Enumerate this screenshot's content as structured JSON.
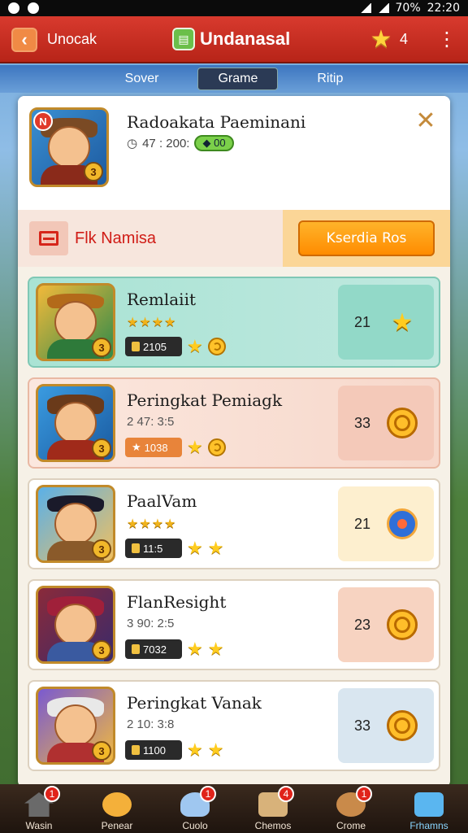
{
  "status_bar": {
    "battery": "70%",
    "time": "22:20"
  },
  "header": {
    "back_label": "Unocak",
    "title": "Undanasal",
    "star_count": "4"
  },
  "tabs": [
    {
      "label": "Sover"
    },
    {
      "label": "Grame"
    },
    {
      "label": "Ritip"
    }
  ],
  "profile": {
    "name": "Radoakata Paeminani",
    "meta": "47 : 200:",
    "pill": "00",
    "level": "3",
    "badge": "N"
  },
  "actions": {
    "left_label": "Flk Namisa",
    "right_button": "Kserdia Ros"
  },
  "players": [
    {
      "name": "Remlaiit",
      "stars": "★★★★",
      "sub": "",
      "chip": "2105",
      "rank": "21",
      "level": "3",
      "icon": "star-icon",
      "chip_style": "dark"
    },
    {
      "name": "Peringkat Pemiagk",
      "stars": "",
      "sub": "2 47: 3:5",
      "chip": "1038",
      "rank": "33",
      "level": "3",
      "icon": "ring-icon",
      "chip_style": "orange"
    },
    {
      "name": "PaalVam",
      "stars": "★★★★",
      "sub": "",
      "chip": "11:5",
      "rank": "21",
      "level": "3",
      "icon": "bomb-icon",
      "chip_style": "dark"
    },
    {
      "name": "FlanResight",
      "stars": "",
      "sub": "3 90: 2:5",
      "chip": "7032",
      "rank": "23",
      "level": "3",
      "icon": "ring-icon",
      "chip_style": "dark"
    },
    {
      "name": "Peringkat Vanak",
      "stars": "",
      "sub": "2 10: 3:8",
      "chip": "1100",
      "rank": "33",
      "level": "3",
      "icon": "ring-icon",
      "chip_style": "dark"
    }
  ],
  "bottom_nav": [
    {
      "label": "Wasin",
      "badge": "1"
    },
    {
      "label": "Penear",
      "badge": ""
    },
    {
      "label": "Cuolo",
      "badge": "1"
    },
    {
      "label": "Chemos",
      "badge": "4"
    },
    {
      "label": "Crome",
      "badge": "1"
    },
    {
      "label": "Frhamns",
      "badge": ""
    }
  ]
}
